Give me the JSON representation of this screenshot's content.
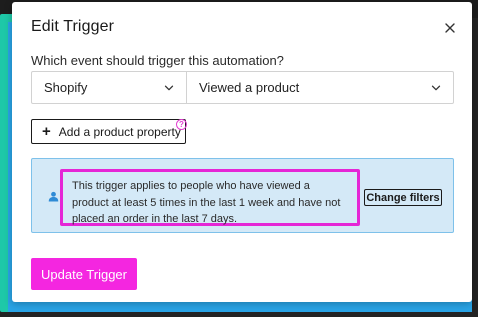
{
  "modal": {
    "title": "Edit Trigger",
    "close_icon": "close-icon"
  },
  "trigger": {
    "question": "Which event should trigger this automation?",
    "platform_select": {
      "value": "Shopify"
    },
    "event_select": {
      "value": "Viewed a product"
    }
  },
  "add_property": {
    "label": "Add a product property",
    "plus_glyph": "+",
    "help_glyph": "?"
  },
  "info": {
    "text": "This trigger applies to people who have viewed a product at least 5 times in the last 1 week and have not placed an order in the last 7 days.",
    "change_filters_label": "Change filters"
  },
  "footer": {
    "update_label": "Update Trigger"
  },
  "colors": {
    "accent": "#f426e0",
    "info_background": "#d4e9f7",
    "highlight": "#e526d6"
  }
}
